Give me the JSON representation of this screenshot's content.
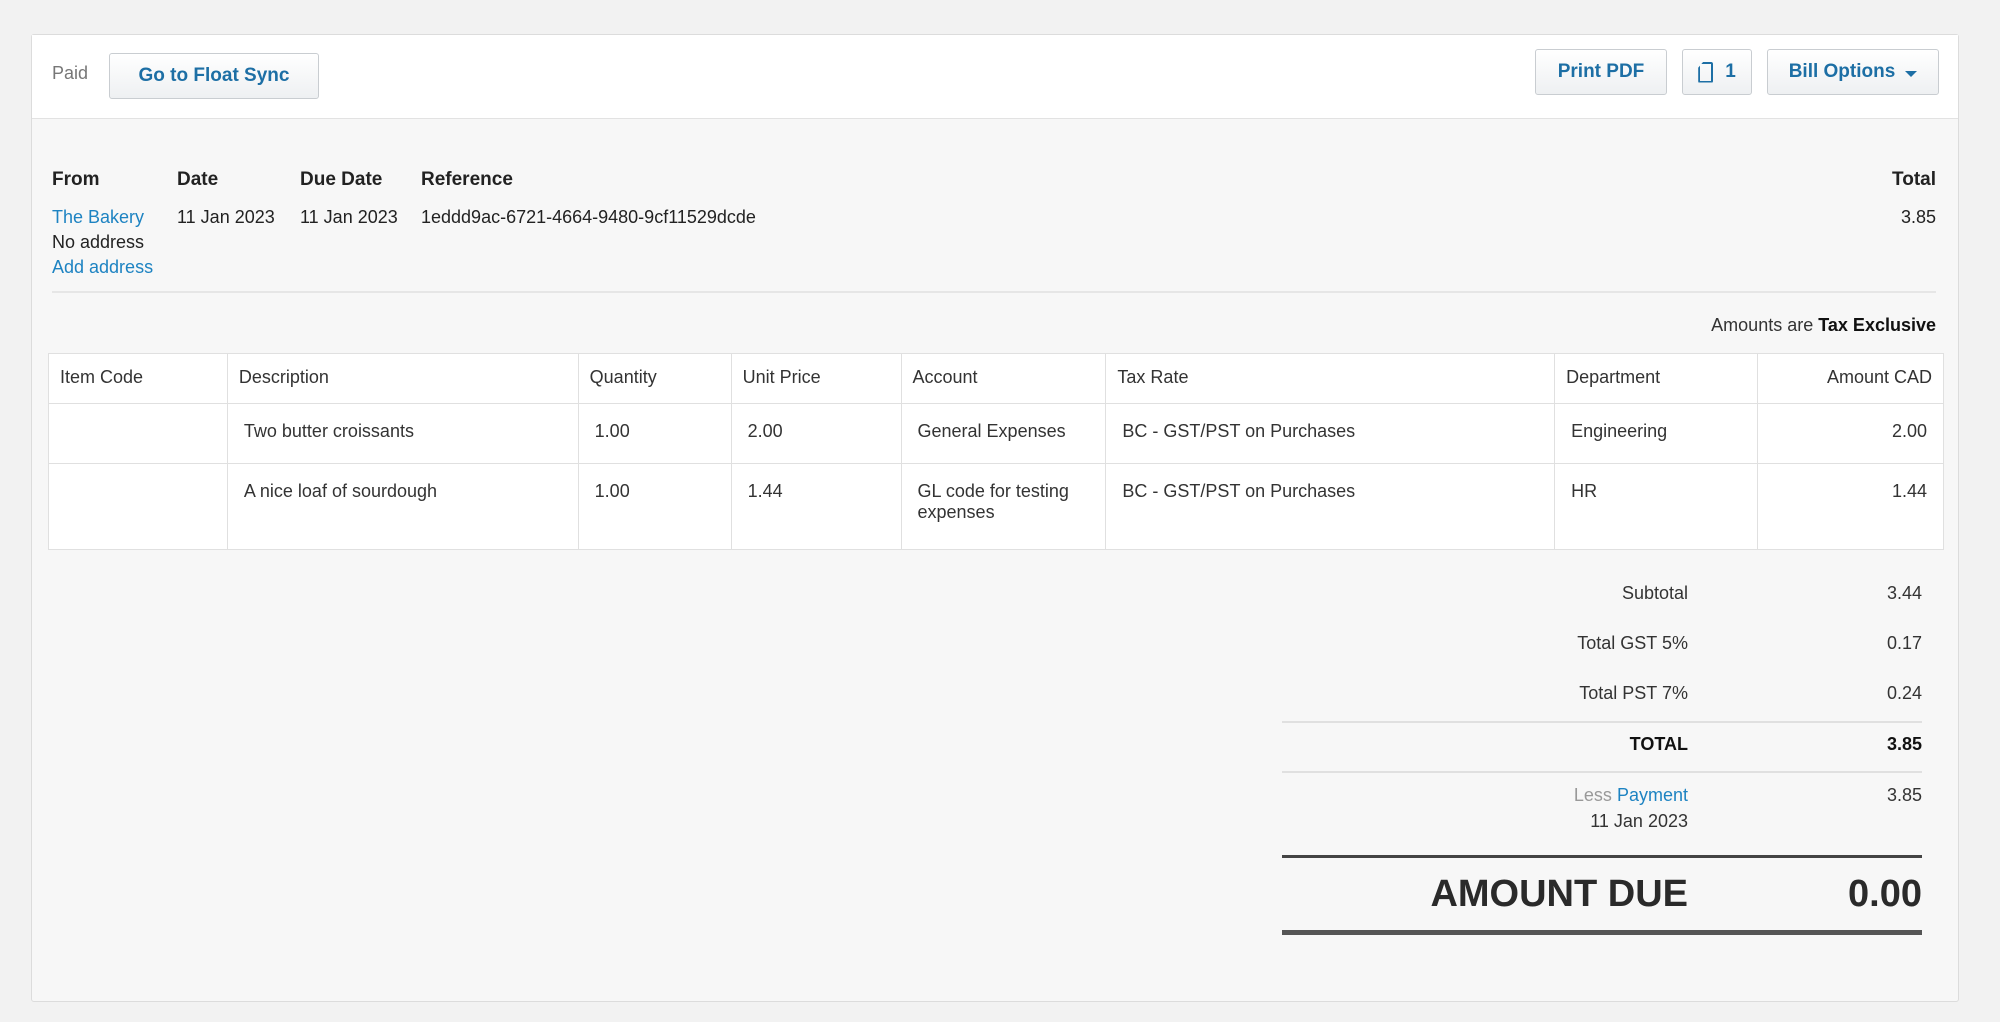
{
  "toolbar": {
    "status": "Paid",
    "sync_label": "Go to Float Sync",
    "print_label": "Print PDF",
    "files_count": "1",
    "options_label": "Bill Options",
    "file_icon": "file-icon",
    "caret_icon": "chevron-down-icon"
  },
  "header": {
    "from_label": "From",
    "date_label": "Date",
    "due_label": "Due Date",
    "ref_label": "Reference",
    "total_label": "Total",
    "from_value": "The Bakery",
    "no_address": "No address",
    "add_address": "Add address",
    "date_value": "11 Jan 2023",
    "due_value": "11 Jan 2023",
    "ref_value": "1eddd9ac-6721-4664-9480-9cf11529dcde",
    "total_value": "3.85"
  },
  "tax_note": {
    "prefix": "Amounts are",
    "mode": "Tax Exclusive"
  },
  "table": {
    "columns": [
      "Item Code",
      "Description",
      "Quantity",
      "Unit Price",
      "Account",
      "Tax Rate",
      "Department",
      "Amount CAD"
    ],
    "rows": [
      [
        "",
        "Two butter croissants",
        "1.00",
        "2.00",
        "General Expenses",
        "BC - GST/PST on Purchases",
        "Engineering",
        "2.00"
      ],
      [
        "",
        "A nice loaf of sourdough",
        "1.00",
        "1.44",
        "GL code for testing expenses",
        "BC - GST/PST on Purchases",
        "HR",
        "1.44"
      ]
    ]
  },
  "totals": {
    "subtotal_label": "Subtotal",
    "subtotal": "3.44",
    "gst_label": "Total GST 5%",
    "gst": "0.17",
    "pst_label": "Total PST 7%",
    "pst": "0.24",
    "total_label": "TOTAL",
    "total": "3.85",
    "less_label": "Less",
    "payment_label": "Payment",
    "payment_date": "11 Jan 2023",
    "payment": "3.85",
    "amount_due_label": "AMOUNT DUE",
    "amount_due": "0.00"
  },
  "colors": {
    "link": "#1d83c2",
    "button_text": "#1d6fa5"
  }
}
